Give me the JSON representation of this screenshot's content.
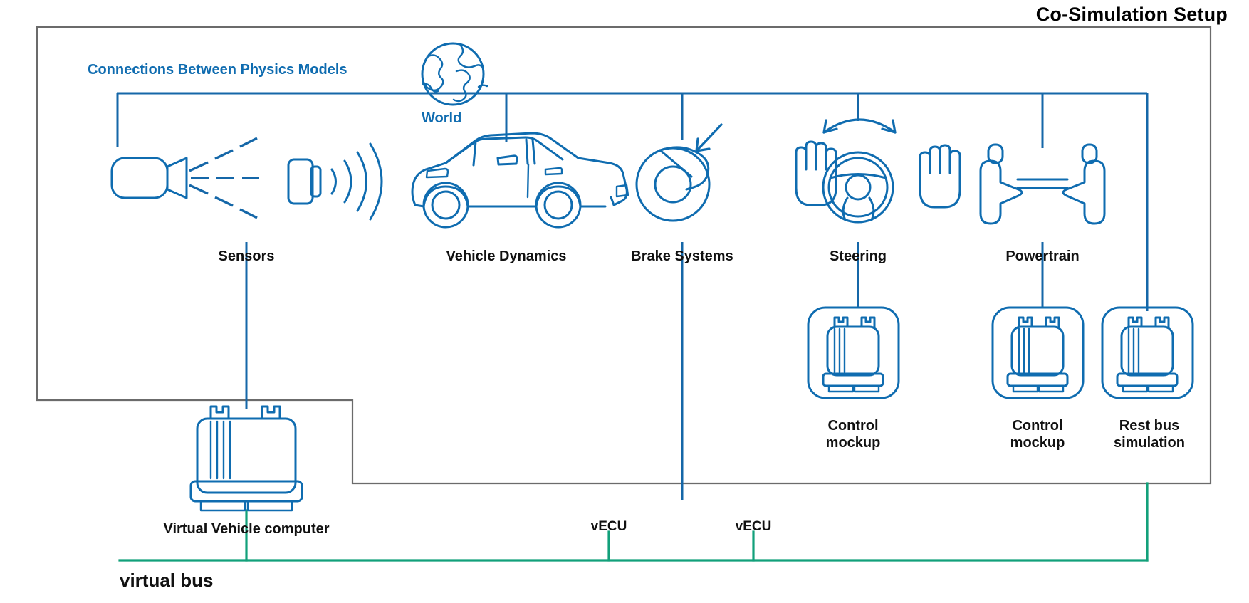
{
  "diagram": {
    "title": "Co-Simulation Setup",
    "connections_label": "Connections Between Physics Models",
    "world_label": "World",
    "virtual_bus_label": "virtual bus",
    "virtual_vehicle_computer_label": "Virtual Vehicle computer",
    "colors": {
      "accent_blue": "#0f6cb0",
      "bus_green": "#12a07a",
      "frame_gray": "#6b6b6b",
      "text_black": "#111111"
    },
    "physics_nodes": [
      {
        "id": "sensors",
        "label": "Sensors",
        "icon": "lidar-sensor-icon"
      },
      {
        "id": "vehicle-dynamics",
        "label": "Vehicle Dynamics",
        "icon": "car-icon"
      },
      {
        "id": "brake-systems",
        "label": "Brake Systems",
        "icon": "brake-disc-icon"
      },
      {
        "id": "steering",
        "label": "Steering",
        "icon": "steering-wheel-icon"
      },
      {
        "id": "powertrain",
        "label": "Powertrain",
        "icon": "axle-icon"
      }
    ],
    "ecu_nodes": [
      {
        "id": "steering-control-mockup",
        "label": "Control\nmockup",
        "icon": "ecu-icon"
      },
      {
        "id": "powertrain-control-mockup",
        "label": "Control\nmockup",
        "icon": "ecu-icon"
      },
      {
        "id": "rest-bus-simulation",
        "label": "Rest bus\nsimulation",
        "icon": "ecu-icon"
      }
    ],
    "bus_taps": [
      {
        "id": "vecu-1",
        "label": "vECU"
      },
      {
        "id": "vecu-2",
        "label": "vECU"
      }
    ]
  }
}
